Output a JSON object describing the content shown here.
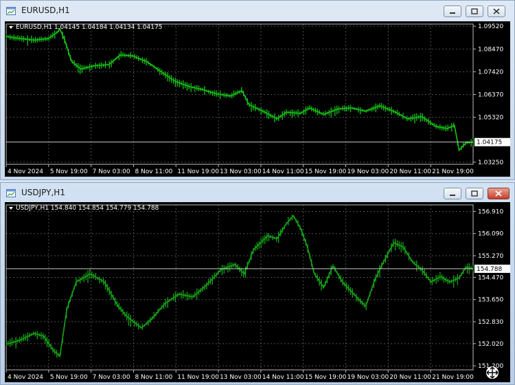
{
  "windows": [
    {
      "title": "EURUSD,H1",
      "info": "EURUSD,H1  1.04145 1.04184 1.04134 1.04175",
      "price_tag": "1.04175",
      "close_active": false,
      "grid_color": "#505050",
      "series_color": "#16c116",
      "chart_data": {
        "type": "line",
        "symbol": "EURUSD",
        "timeframe": "H1",
        "yticks": [
          "1.09520",
          "1.08470",
          "1.07420",
          "1.06370",
          "1.05320",
          "1.04175",
          "1.03250"
        ],
        "ylim": [
          1.0315,
          1.0962
        ],
        "xticks": [
          "4 Nov 2024",
          "5 Nov 19:00",
          "7 Nov 03:00",
          "8 Nov 11:00",
          "11 Nov 19:00",
          "13 Nov 03:00",
          "14 Nov 11:00",
          "15 Nov 19:00",
          "19 Nov 03:00",
          "20 Nov 11:00",
          "21 Nov 19:00"
        ],
        "last": 1.04175,
        "path": [
          [
            0,
            1.0905
          ],
          [
            0.03,
            1.0895
          ],
          [
            0.06,
            1.0888
          ],
          [
            0.09,
            1.0895
          ],
          [
            0.11,
            1.0925
          ],
          [
            0.115,
            1.094
          ],
          [
            0.125,
            1.089
          ],
          [
            0.14,
            1.079
          ],
          [
            0.16,
            1.0755
          ],
          [
            0.19,
            1.077
          ],
          [
            0.22,
            1.0775
          ],
          [
            0.245,
            1.082
          ],
          [
            0.27,
            1.0815
          ],
          [
            0.3,
            1.079
          ],
          [
            0.33,
            1.0745
          ],
          [
            0.36,
            1.07
          ],
          [
            0.39,
            1.0675
          ],
          [
            0.42,
            1.066
          ],
          [
            0.45,
            1.064
          ],
          [
            0.48,
            1.063
          ],
          [
            0.505,
            1.0655
          ],
          [
            0.52,
            1.059
          ],
          [
            0.55,
            1.056
          ],
          [
            0.58,
            1.0525
          ],
          [
            0.6,
            1.0555
          ],
          [
            0.63,
            1.055
          ],
          [
            0.65,
            1.0575
          ],
          [
            0.68,
            1.0545
          ],
          [
            0.71,
            1.057
          ],
          [
            0.74,
            1.0575
          ],
          [
            0.77,
            1.056
          ],
          [
            0.8,
            1.0585
          ],
          [
            0.83,
            1.056
          ],
          [
            0.86,
            1.0525
          ],
          [
            0.89,
            1.0535
          ],
          [
            0.92,
            1.049
          ],
          [
            0.945,
            1.048
          ],
          [
            0.96,
            1.0495
          ],
          [
            0.97,
            1.038
          ],
          [
            0.985,
            1.0415
          ],
          [
            1.0,
            1.04175
          ]
        ]
      }
    },
    {
      "title": "USDJPY,H1",
      "info": "USDJPY,H1  154.840 154.854 154.779 154.788",
      "price_tag": "154.788",
      "close_active": true,
      "grid_color": "#505050",
      "series_color": "#16a316",
      "chart_data": {
        "type": "line",
        "symbol": "USDJPY",
        "timeframe": "H1",
        "yticks": [
          "156.910",
          "156.090",
          "155.270",
          "154.788",
          "154.470",
          "153.650",
          "152.830",
          "152.020",
          "151.200"
        ],
        "ylim": [
          151.05,
          157.15
        ],
        "xticks": [
          "4 Nov 2024",
          "5 Nov 19:00",
          "7 Nov 03:00",
          "8 Nov 11:00",
          "11 Nov 19:00",
          "13 Nov 03:00",
          "14 Nov 11:00",
          "15 Nov 19:00",
          "19 Nov 03:00",
          "20 Nov 11:00",
          "21 Nov 19:00"
        ],
        "last": 154.788,
        "path": [
          [
            0,
            152.0
          ],
          [
            0.03,
            152.15
          ],
          [
            0.06,
            152.4
          ],
          [
            0.08,
            152.3
          ],
          [
            0.1,
            151.8
          ],
          [
            0.115,
            151.55
          ],
          [
            0.13,
            153.3
          ],
          [
            0.15,
            154.3
          ],
          [
            0.18,
            154.6
          ],
          [
            0.21,
            154.3
          ],
          [
            0.24,
            153.4
          ],
          [
            0.26,
            153.0
          ],
          [
            0.29,
            152.6
          ],
          [
            0.31,
            152.9
          ],
          [
            0.34,
            153.5
          ],
          [
            0.37,
            153.85
          ],
          [
            0.4,
            153.75
          ],
          [
            0.43,
            154.2
          ],
          [
            0.46,
            154.75
          ],
          [
            0.49,
            154.95
          ],
          [
            0.51,
            154.6
          ],
          [
            0.53,
            155.5
          ],
          [
            0.56,
            156.0
          ],
          [
            0.58,
            155.9
          ],
          [
            0.6,
            156.45
          ],
          [
            0.615,
            156.75
          ],
          [
            0.63,
            156.3
          ],
          [
            0.645,
            155.6
          ],
          [
            0.66,
            154.6
          ],
          [
            0.68,
            154.1
          ],
          [
            0.7,
            154.9
          ],
          [
            0.72,
            154.3
          ],
          [
            0.75,
            153.75
          ],
          [
            0.77,
            153.4
          ],
          [
            0.79,
            154.4
          ],
          [
            0.81,
            155.1
          ],
          [
            0.83,
            155.75
          ],
          [
            0.85,
            155.6
          ],
          [
            0.87,
            155.05
          ],
          [
            0.89,
            154.75
          ],
          [
            0.91,
            154.3
          ],
          [
            0.93,
            154.5
          ],
          [
            0.95,
            154.3
          ],
          [
            0.97,
            154.45
          ],
          [
            0.985,
            154.85
          ],
          [
            1.0,
            154.788
          ]
        ]
      }
    }
  ]
}
